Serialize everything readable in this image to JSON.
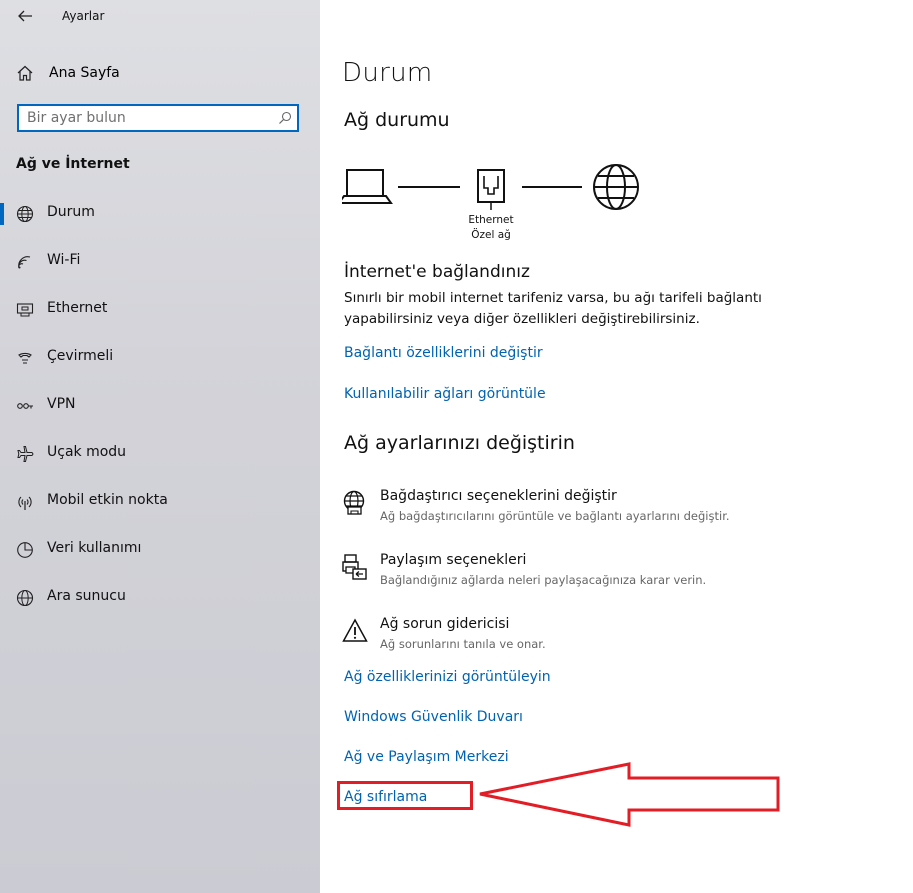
{
  "app": {
    "title": "Ayarlar"
  },
  "sidebar": {
    "home_label": "Ana Sayfa",
    "search_placeholder": "Bir ayar bulun",
    "section_title": "Ağ ve İnternet",
    "items": [
      {
        "label": "Durum",
        "icon": "globe-status-icon",
        "active": true
      },
      {
        "label": "Wi-Fi",
        "icon": "wifi-icon"
      },
      {
        "label": "Ethernet",
        "icon": "ethernet-icon"
      },
      {
        "label": "Çevirmeli",
        "icon": "dialup-icon"
      },
      {
        "label": "VPN",
        "icon": "vpn-icon"
      },
      {
        "label": "Uçak modu",
        "icon": "airplane-icon"
      },
      {
        "label": "Mobil etkin nokta",
        "icon": "hotspot-icon"
      },
      {
        "label": "Veri kullanımı",
        "icon": "data-usage-icon"
      },
      {
        "label": "Ara sunucu",
        "icon": "proxy-globe-icon"
      }
    ]
  },
  "main": {
    "title": "Durum",
    "network_status_heading": "Ağ durumu",
    "diagram": {
      "adapter_name": "Ethernet",
      "network_type": "Özel ağ"
    },
    "connected_title": "İnternet'e bağlandınız",
    "connected_desc": "Sınırlı bir mobil internet tarifeniz varsa, bu ağı tarifeli bağlantı yapabilirsiniz veya diğer özellikleri değiştirebilirsiniz.",
    "links_top": [
      "Bağlantı özelliklerini değiştir",
      "Kullanılabilir ağları görüntüle"
    ],
    "change_heading": "Ağ ayarlarınızı değiştirin",
    "options": [
      {
        "title": "Bağdaştırıcı seçeneklerini değiştir",
        "subtitle": "Ağ bağdaştırıcılarını görüntüle ve bağlantı ayarlarını değiştir.",
        "icon": "adapter-globe-icon"
      },
      {
        "title": "Paylaşım seçenekleri",
        "subtitle": "Bağlandığınız ağlarda neleri paylaşacağınıza karar verin.",
        "icon": "sharing-printer-icon"
      },
      {
        "title": "Ağ sorun gidericisi",
        "subtitle": "Ağ sorunlarını tanıla ve onar.",
        "icon": "warning-triangle-icon"
      }
    ],
    "links_bottom": [
      "Ağ özelliklerinizi görüntüleyin",
      "Windows Güvenlik Duvarı",
      "Ağ ve Paylaşım Merkezi",
      "Ağ sıfırlama"
    ]
  },
  "colors": {
    "accent": "#0067c0",
    "link": "#0063b1",
    "annotation_red": "#e21d25"
  }
}
